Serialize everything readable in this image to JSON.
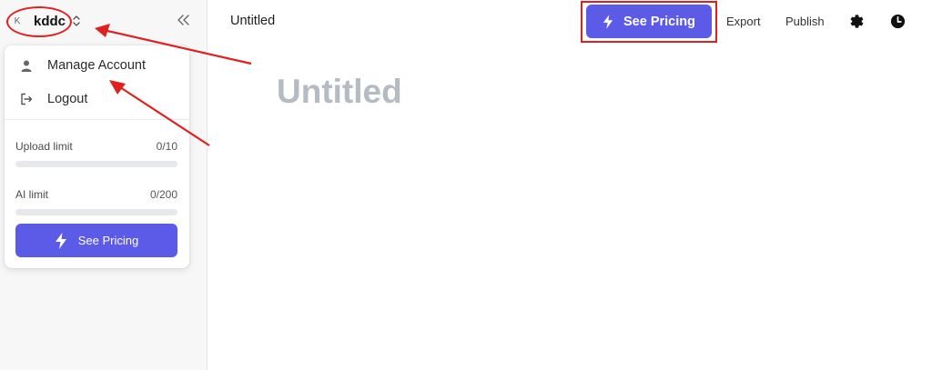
{
  "workspace": {
    "avatar_initial": "K",
    "name": "kddc"
  },
  "dropdown": {
    "items": [
      {
        "label": "Manage Account",
        "icon": "user-icon"
      },
      {
        "label": "Logout",
        "icon": "logout-icon"
      }
    ],
    "limits": {
      "upload": {
        "label": "Upload limit",
        "value": "0/10",
        "used_fraction": 0
      },
      "ai": {
        "label": "AI limit",
        "value": "0/200",
        "used_fraction": 0
      }
    },
    "pricing_label": "See Pricing"
  },
  "topbar": {
    "doc_title": "Untitled",
    "pricing_label": "See Pricing",
    "export_label": "Export",
    "publish_label": "Publish",
    "settings_icon": "gear-icon",
    "history_icon": "clock-icon"
  },
  "editor": {
    "title": "Untitled"
  },
  "colors": {
    "accent": "#5b5be8",
    "annotation": "#e02020",
    "sidebar_bg": "#f7f7f8",
    "placeholder_title": "#b5bbc3"
  }
}
